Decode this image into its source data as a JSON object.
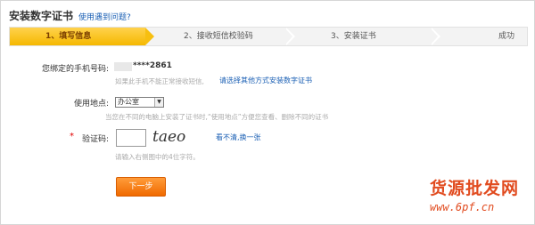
{
  "header": {
    "title": "安装数字证书",
    "help_link": "使用遇到问题?"
  },
  "steps": [
    {
      "label": "1、填写信息",
      "active": true
    },
    {
      "label": "2、接收短信校验码",
      "active": false
    },
    {
      "label": "3、安装证书",
      "active": false
    },
    {
      "label": "成功",
      "active": false
    }
  ],
  "phone": {
    "label": "您绑定的手机号码:",
    "masked_value": "****2861",
    "hint": "如果此手机不能正常接收短信,",
    "alt_link": "请选择其他方式安装数字证书"
  },
  "location": {
    "label": "使用地点:",
    "selected": "办公室",
    "hint": "当您在不同的电脑上安装了证书时,“使用地点”方便您查看、删除不同的证书"
  },
  "captcha": {
    "required_mark": "*",
    "label": "验证码:",
    "image_text": "taeo",
    "refresh_link": "看不清,换一张",
    "hint": "请输入右侧图中的4位字符。"
  },
  "actions": {
    "next_label": "下一步"
  },
  "watermark": {
    "text": "货源批发网",
    "url": "www.6pf.cn"
  },
  "colors": {
    "step_active": "#f5b800",
    "link": "#1a5fb4",
    "button": "#f06a00",
    "required": "#e10000",
    "watermark": "#e14b1f"
  }
}
